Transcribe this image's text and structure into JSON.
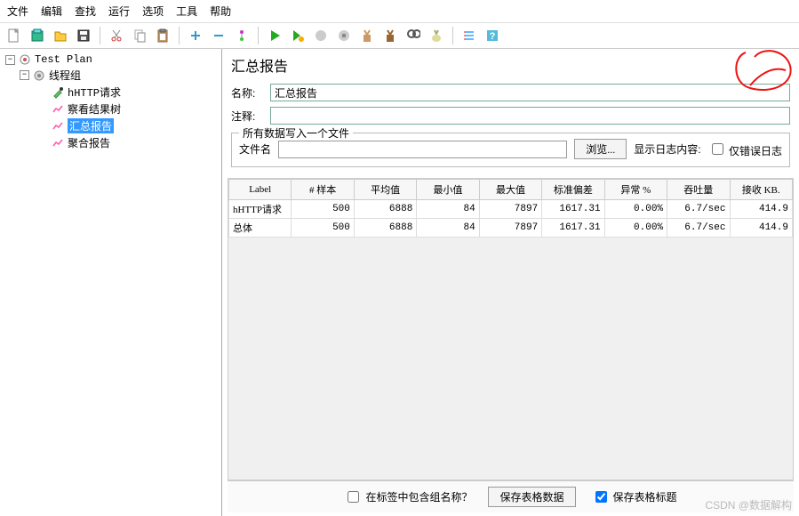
{
  "menu": [
    "文件",
    "编辑",
    "查找",
    "运行",
    "选项",
    "工具",
    "帮助"
  ],
  "tree": {
    "root": "Test Plan",
    "group": "线程组",
    "items": [
      {
        "label": "hHTTP请求",
        "icon": "dropper"
      },
      {
        "label": "察看结果树",
        "icon": "chart"
      },
      {
        "label": "汇总报告",
        "icon": "chart",
        "selected": true
      },
      {
        "label": "聚合报告",
        "icon": "chart"
      }
    ]
  },
  "panel": {
    "title": "汇总报告",
    "name_label": "名称:",
    "name_value": "汇总报告",
    "comment_label": "注释:",
    "comment_value": "",
    "filegroup_title": "所有数据写入一个文件",
    "filename_label": "文件名",
    "browse_btn": "浏览...",
    "log_label": "显示日志内容:",
    "errors_only": "仅错误日志"
  },
  "table": {
    "headers": [
      "Label",
      "# 样本",
      "平均值",
      "最小值",
      "最大值",
      "标准偏差",
      "异常 %",
      "吞吐量",
      "接收 KB."
    ],
    "rows": [
      {
        "label": "hHTTP请求",
        "samples": "500",
        "avg": "6888",
        "min": "84",
        "max": "7897",
        "stddev": "1617.31",
        "error": "0.00%",
        "throughput": "6.7/sec",
        "recv": "414.9"
      },
      {
        "label": "总体",
        "samples": "500",
        "avg": "6888",
        "min": "84",
        "max": "7897",
        "stddev": "1617.31",
        "error": "0.00%",
        "throughput": "6.7/sec",
        "recv": "414.9"
      }
    ]
  },
  "footer": {
    "include_group": "在标签中包含组名称？",
    "save_data": "保存表格数据",
    "save_header": "保存表格标题"
  },
  "watermark": "CSDN @数据解构"
}
